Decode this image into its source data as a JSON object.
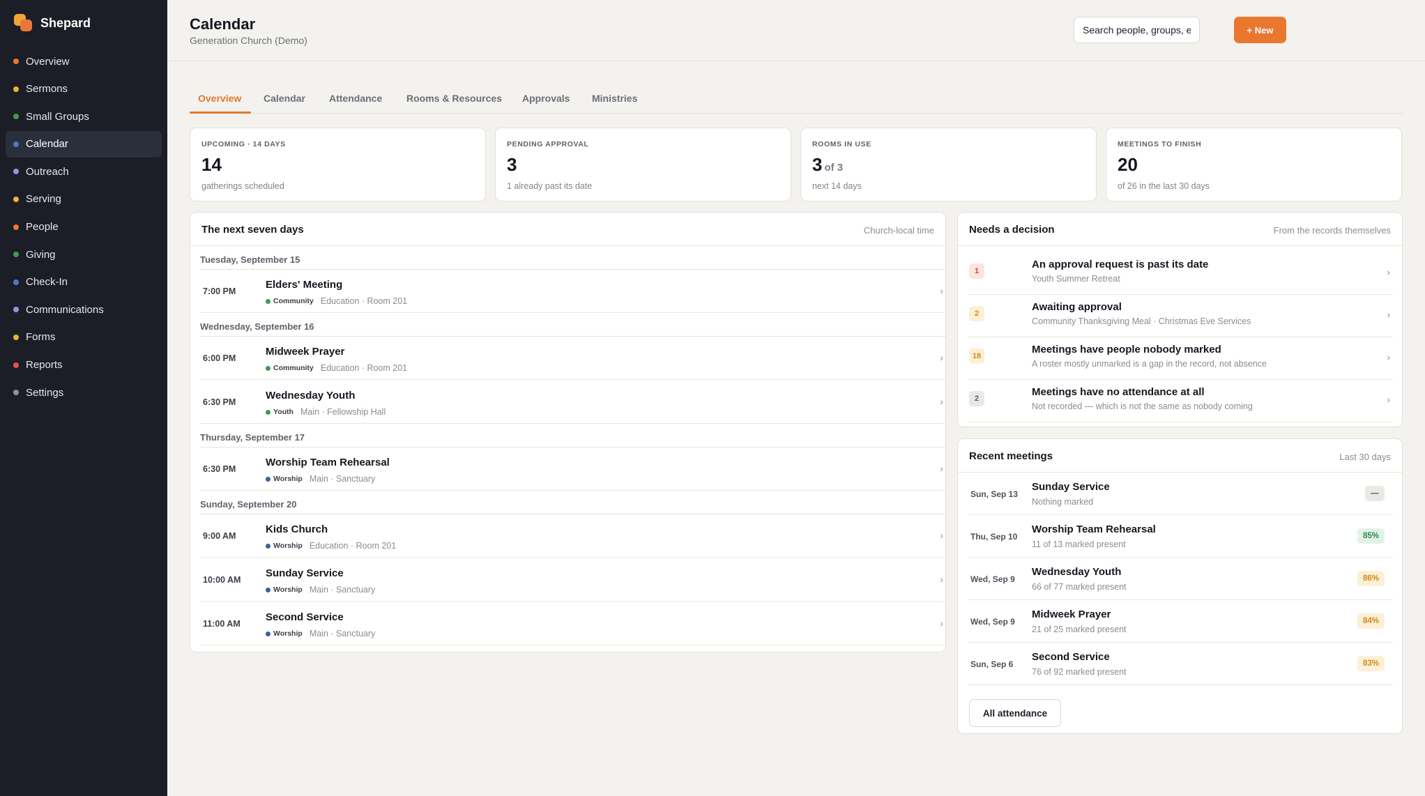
{
  "app": {
    "name": "Shepard"
  },
  "sidebar": {
    "items": [
      {
        "label": "Overview",
        "dot": "#e9772f"
      },
      {
        "label": "Sermons",
        "dot": "#f0b13a"
      },
      {
        "label": "Small Groups",
        "dot": "#3e9a5a"
      },
      {
        "label": "Calendar",
        "dot": "#4a7cc9",
        "active": true
      },
      {
        "label": "Outreach",
        "dot": "#a98ae0"
      },
      {
        "label": "Serving",
        "dot": "#f0b13a"
      },
      {
        "label": "People",
        "dot": "#e9772f"
      },
      {
        "label": "Giving",
        "dot": "#3e9a5a"
      },
      {
        "label": "Check-In",
        "dot": "#4a7cc9"
      },
      {
        "label": "Communications",
        "dot": "#a98ae0"
      },
      {
        "label": "Forms",
        "dot": "#f0b13a"
      },
      {
        "label": "Reports",
        "dot": "#e2573f"
      },
      {
        "label": "Settings",
        "dot": "#8f929a"
      }
    ]
  },
  "header": {
    "title": "Calendar",
    "subtitle": "Generation Church (Demo)",
    "search_placeholder": "Search people, groups, ever",
    "new_button": "+ New"
  },
  "tabs": [
    "Overview",
    "Calendar",
    "Attendance",
    "Rooms & Resources",
    "Approvals",
    "Ministries"
  ],
  "stats": [
    {
      "label": "UPCOMING · 14 DAYS",
      "value": "14",
      "suffix": "",
      "sub": "gatherings scheduled"
    },
    {
      "label": "PENDING APPROVAL",
      "value": "3",
      "suffix": "",
      "sub": "1 already past its date"
    },
    {
      "label": "ROOMS IN USE",
      "value": "3",
      "suffix": "of 3",
      "sub": "next 14 days"
    },
    {
      "label": "MEETINGS TO FINISH",
      "value": "20",
      "suffix": "",
      "sub": "of 26 in the last 30 days"
    }
  ],
  "next_seven": {
    "title": "The next seven days",
    "meta": "Church-local time",
    "days": [
      {
        "label": "Tuesday, September 15",
        "events": [
          {
            "time": "7:00 PM",
            "name": "Elders' Meeting",
            "tag": "Community",
            "tag_color": "#3e9a5a",
            "location": "Education · Room 201"
          }
        ]
      },
      {
        "label": "Wednesday, September 16",
        "events": [
          {
            "time": "6:00 PM",
            "name": "Midweek Prayer",
            "tag": "Community",
            "tag_color": "#3e9a5a",
            "location": "Education · Room 201"
          },
          {
            "time": "6:30 PM",
            "name": "Wednesday Youth",
            "tag": "Youth",
            "tag_color": "#3e9a5a",
            "location": "Main · Fellowship Hall"
          }
        ]
      },
      {
        "label": "Thursday, September 17",
        "events": [
          {
            "time": "6:30 PM",
            "name": "Worship Team Rehearsal",
            "tag": "Worship",
            "tag_color": "#3f5f9e",
            "location": "Main · Sanctuary"
          }
        ]
      },
      {
        "label": "Sunday, September 20",
        "events": [
          {
            "time": "9:00 AM",
            "name": "Kids Church",
            "tag": "Worship",
            "tag_color": "#3f5f9e",
            "location": "Education · Room 201"
          },
          {
            "time": "10:00 AM",
            "name": "Sunday Service",
            "tag": "Worship",
            "tag_color": "#3f5f9e",
            "location": "Main · Sanctuary"
          },
          {
            "time": "11:00 AM",
            "name": "Second Service",
            "tag": "Worship",
            "tag_color": "#3f5f9e",
            "location": "Main · Sanctuary"
          }
        ]
      }
    ]
  },
  "decisions": {
    "title": "Needs a decision",
    "meta": "From the records themselves",
    "items": [
      {
        "count": "1",
        "tone": "red",
        "title": "An approval request is past its date",
        "desc": "Youth Summer Retreat"
      },
      {
        "count": "2",
        "tone": "amber",
        "title": "Awaiting approval",
        "desc": "Community Thanksgiving Meal · Christmas Eve Services"
      },
      {
        "count": "18",
        "tone": "amber",
        "title": "Meetings have people nobody marked",
        "desc": "A roster mostly unmarked is a gap in the record, not absence"
      },
      {
        "count": "2",
        "tone": "gray",
        "title": "Meetings have no attendance at all",
        "desc": "Not recorded — which is not the same as nobody coming"
      }
    ]
  },
  "recent": {
    "title": "Recent meetings",
    "meta": "Last 30 days",
    "items": [
      {
        "date": "Sun, Sep 13",
        "name": "Sunday Service",
        "detail": "Nothing marked",
        "pct": "—",
        "tone": "none"
      },
      {
        "date": "Thu, Sep 10",
        "name": "Worship Team Rehearsal",
        "detail": "11 of 13 marked present",
        "pct": "85%",
        "tone": "green"
      },
      {
        "date": "Wed, Sep 9",
        "name": "Wednesday Youth",
        "detail": "66 of 77 marked present",
        "pct": "86%",
        "tone": "amber"
      },
      {
        "date": "Wed, Sep 9",
        "name": "Midweek Prayer",
        "detail": "21 of 25 marked present",
        "pct": "84%",
        "tone": "amber"
      },
      {
        "date": "Sun, Sep 6",
        "name": "Second Service",
        "detail": "76 of 92 marked present",
        "pct": "83%",
        "tone": "amber"
      }
    ],
    "all_button": "All attendance"
  }
}
